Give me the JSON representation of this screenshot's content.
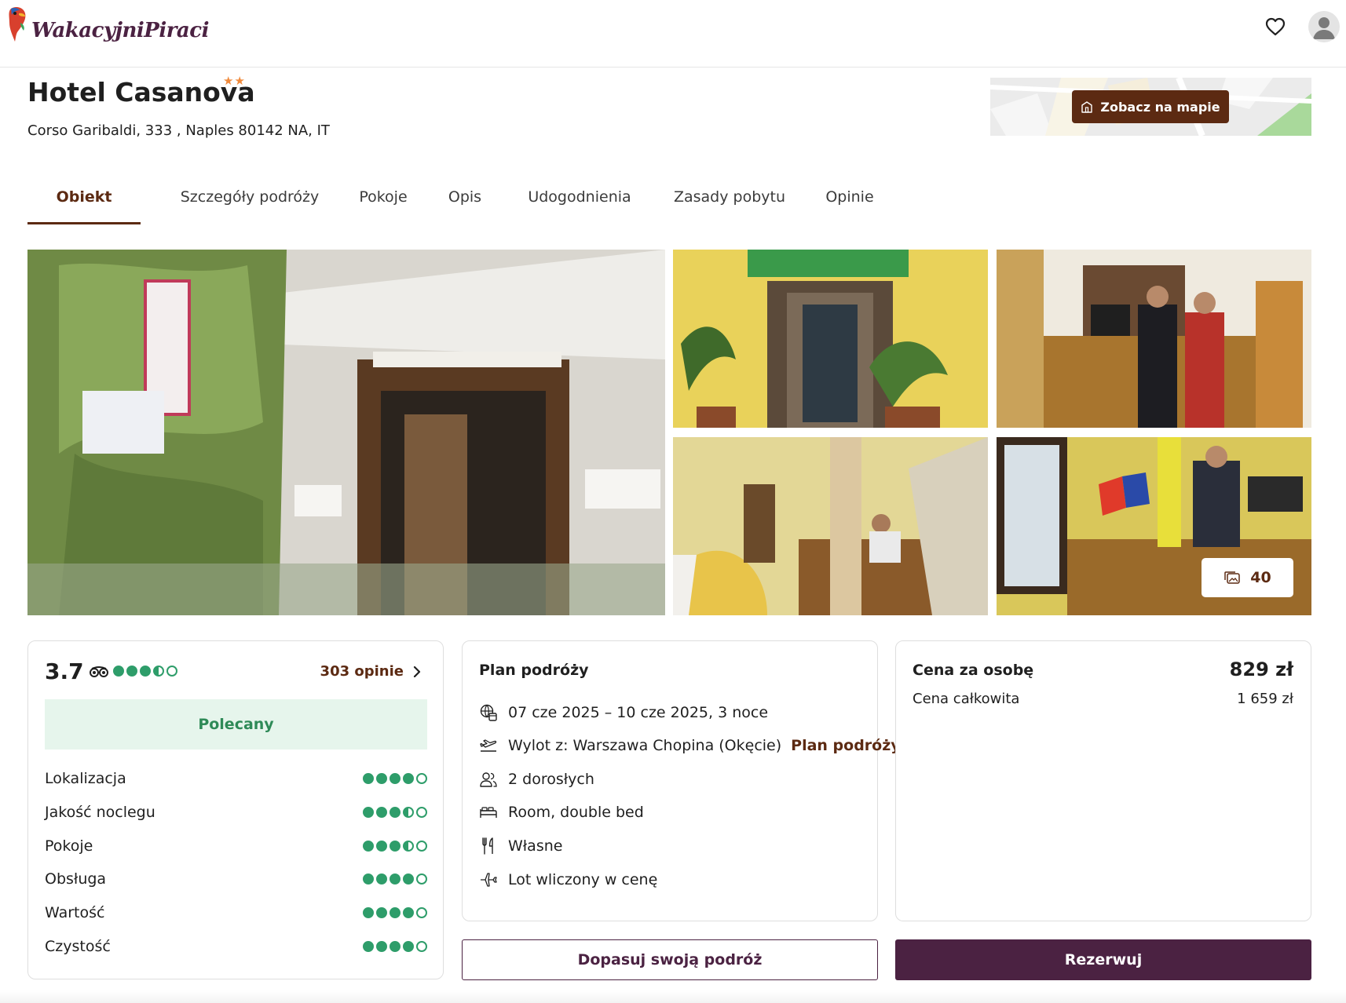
{
  "brand": {
    "name": "WakacyjniPiraci"
  },
  "hotel": {
    "name": "Hotel Casanova",
    "stars": "★★",
    "address": "Corso Garibaldi, 333 , Naples 80142 NA, IT",
    "map_button": "Zobacz na mapie"
  },
  "tabs": [
    {
      "label": "Obiekt",
      "active": true
    },
    {
      "label": "Szczegóły podróży",
      "active": false
    },
    {
      "label": "Pokoje",
      "active": false
    },
    {
      "label": "Opis",
      "active": false
    },
    {
      "label": "Udogodnienia",
      "active": false
    },
    {
      "label": "Zasady pobytu",
      "active": false
    },
    {
      "label": "Opinie",
      "active": false
    }
  ],
  "gallery": {
    "photo_count": "40"
  },
  "rating": {
    "score": "3.7",
    "score_dots": 3.5,
    "reviews_link": "303 opinie",
    "badge": "Polecany",
    "categories": [
      {
        "label": "Lokalizacja",
        "dots": 4
      },
      {
        "label": "Jakość noclegu",
        "dots": 3.5
      },
      {
        "label": "Pokoje",
        "dots": 3.5
      },
      {
        "label": "Obsługa",
        "dots": 4
      },
      {
        "label": "Wartość",
        "dots": 4
      },
      {
        "label": "Czystość",
        "dots": 4
      }
    ]
  },
  "plan": {
    "title": "Plan podróży",
    "dates": "07 cze 2025 – 10 cze 2025, 3 noce",
    "departure": "Wylot z: Warszawa Chopina (Okęcie)",
    "departure_link": "Plan podróży",
    "guests": "2 dorosłych",
    "room": "Room, double bed",
    "board": "Własne",
    "flight": "Lot wliczony w cenę"
  },
  "price": {
    "per_person_label": "Cena za osobę",
    "per_person_value": "829 zł",
    "total_label": "Cena całkowita",
    "total_value": "1 659 zł"
  },
  "actions": {
    "customize": "Dopasuj swoją podróż",
    "book": "Rezerwuj"
  },
  "colors": {
    "brand_purple": "#4b2242",
    "brown_accent": "#5c2a12",
    "rating_green": "#2e9d6a",
    "star_orange": "#f08a3c"
  },
  "icons": {
    "favorite": "heart-icon",
    "profile": "user-icon",
    "map": "building-icon",
    "gallery": "images-icon",
    "tripadvisor": "tripadvisor-owl-icon"
  }
}
